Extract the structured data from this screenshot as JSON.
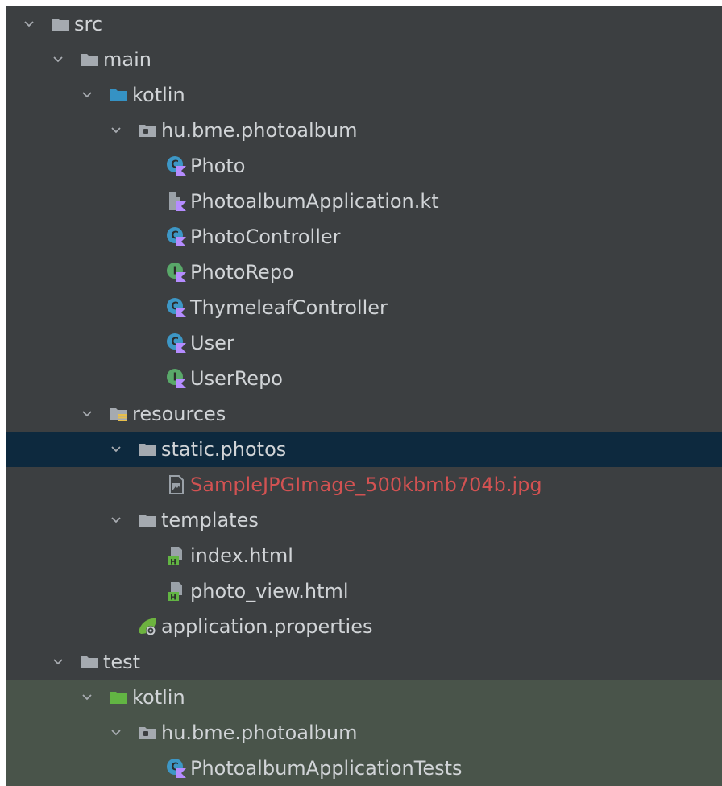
{
  "colors": {
    "panel_bg": "#3c3f41",
    "selected_row_bg": "#0d293e",
    "test_row_bg": "#49544a",
    "text": "#d1d4d7",
    "unversioned_text": "#d25252",
    "folder": "#a5aab0",
    "source_folder": "#3592c4",
    "test_folder": "#62b543",
    "class_icon": "#3d97c6",
    "interface_icon": "#59a869",
    "kotlin_badge": "#b58cff"
  },
  "tree": [
    {
      "label": "src",
      "icon": "folder-icon",
      "expanded": true,
      "depth": 0
    },
    {
      "label": "main",
      "icon": "folder-icon",
      "expanded": true,
      "depth": 1
    },
    {
      "label": "kotlin",
      "icon": "source-folder-icon",
      "expanded": true,
      "depth": 2
    },
    {
      "label": "hu.bme.photoalbum",
      "icon": "package-icon",
      "expanded": true,
      "depth": 3
    },
    {
      "label": "Photo",
      "icon": "kotlin-class-icon",
      "depth": 5
    },
    {
      "label": "PhotoalbumApplication.kt",
      "icon": "kotlin-file-icon",
      "depth": 5
    },
    {
      "label": "PhotoController",
      "icon": "kotlin-class-icon",
      "depth": 5
    },
    {
      "label": "PhotoRepo",
      "icon": "kotlin-interface-icon",
      "depth": 5
    },
    {
      "label": "ThymeleafController",
      "icon": "kotlin-class-icon",
      "depth": 5
    },
    {
      "label": "User",
      "icon": "kotlin-class-icon",
      "depth": 5
    },
    {
      "label": "UserRepo",
      "icon": "kotlin-interface-icon",
      "depth": 5
    },
    {
      "label": "resources",
      "icon": "resources-folder-icon",
      "expanded": true,
      "depth": 2
    },
    {
      "label": "static.photos",
      "icon": "folder-icon",
      "expanded": true,
      "depth": 3,
      "selected": true
    },
    {
      "label": "SampleJPGImage_500kbmb704b.jpg",
      "icon": "image-file-icon",
      "depth": 5,
      "unversioned": true
    },
    {
      "label": "templates",
      "icon": "folder-icon",
      "expanded": true,
      "depth": 3
    },
    {
      "label": "index.html",
      "icon": "html-file-icon",
      "depth": 5
    },
    {
      "label": "photo_view.html",
      "icon": "html-file-icon",
      "depth": 5
    },
    {
      "label": "application.properties",
      "icon": "spring-properties-icon",
      "depth": 4
    },
    {
      "label": "test",
      "icon": "folder-icon",
      "expanded": true,
      "depth": 1
    },
    {
      "label": "kotlin",
      "icon": "test-folder-icon",
      "expanded": true,
      "depth": 2,
      "test_root": true
    },
    {
      "label": "hu.bme.photoalbum",
      "icon": "package-icon",
      "expanded": true,
      "depth": 3,
      "test_root": true
    },
    {
      "label": "PhotoalbumApplicationTests",
      "icon": "kotlin-class-icon",
      "depth": 5,
      "test_root": true
    }
  ]
}
